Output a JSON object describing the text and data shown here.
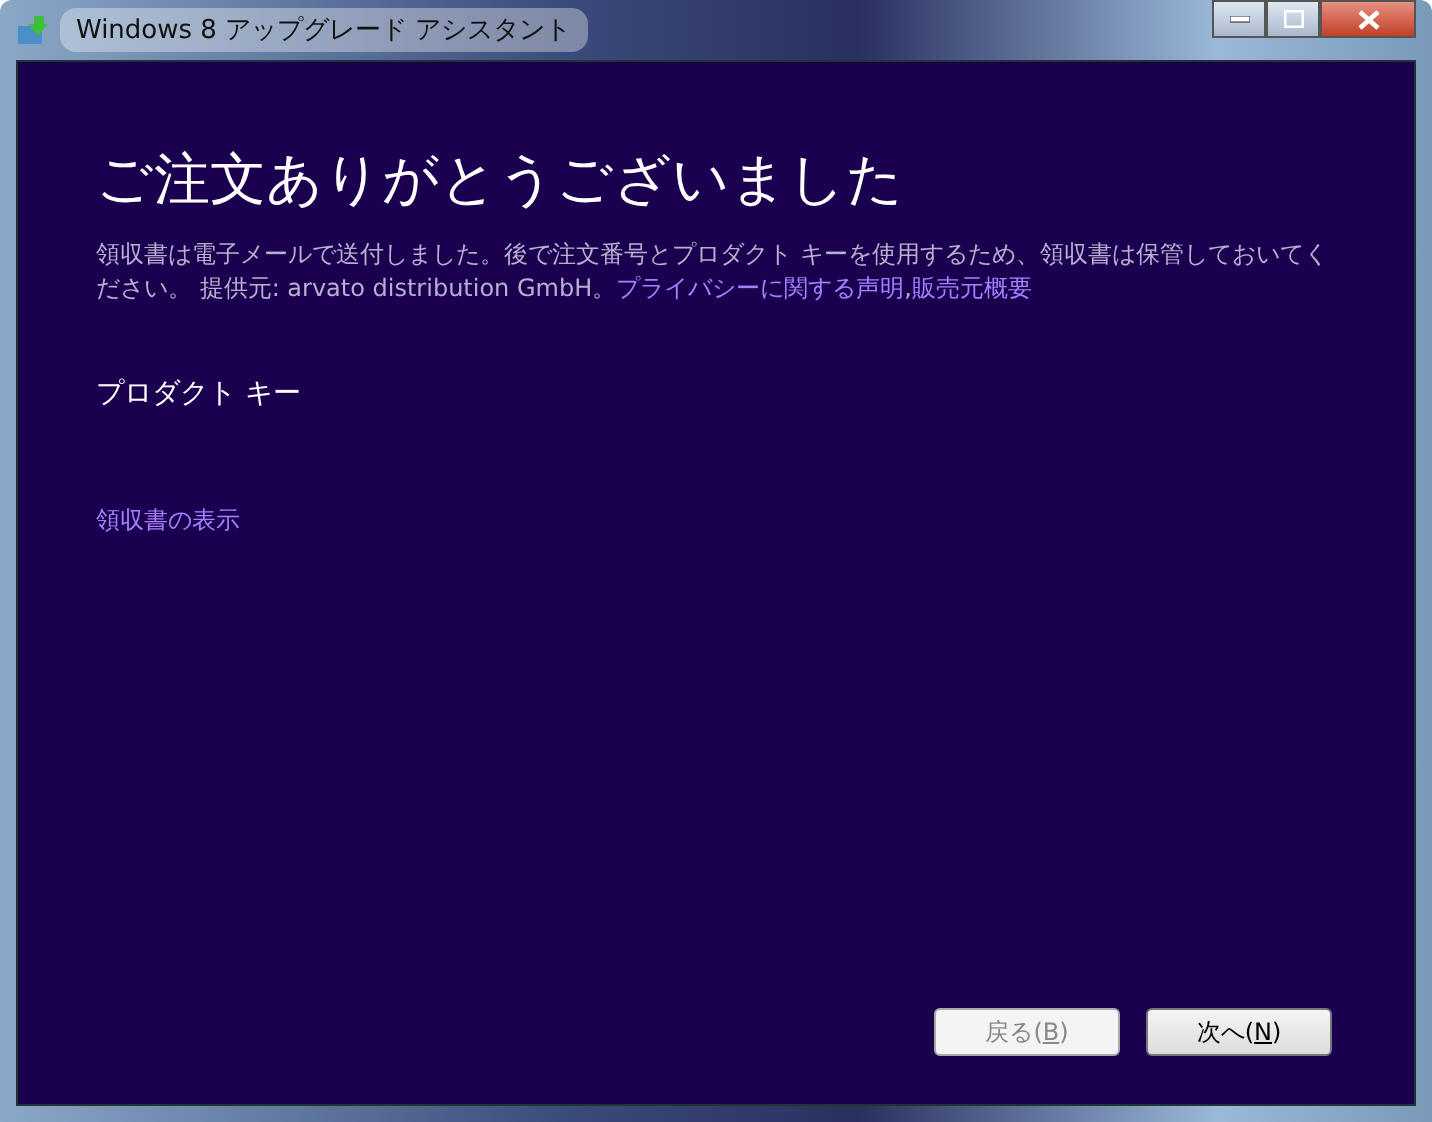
{
  "window": {
    "title": "Windows 8 アップグレード アシスタント"
  },
  "heading": "ご注文ありがとうございました",
  "description": {
    "text": "領収書は電子メールで送付しました。後で注文番号とプロダクト キーを使用するため、領収書は保管しておいてください。 提供元: arvato distribution GmbH。",
    "links": [
      "プライバシーに関する声明",
      "販売元概要"
    ],
    "separator": ","
  },
  "product_key_label": "プロダクト キー",
  "receipt_link": "領収書の表示",
  "buttons": [
    {
      "prefix": "戻る(",
      "access_key": "B",
      "suffix": ")",
      "disabled": true
    },
    {
      "prefix": "次へ(",
      "access_key": "N",
      "suffix": ")",
      "disabled": false
    }
  ]
}
